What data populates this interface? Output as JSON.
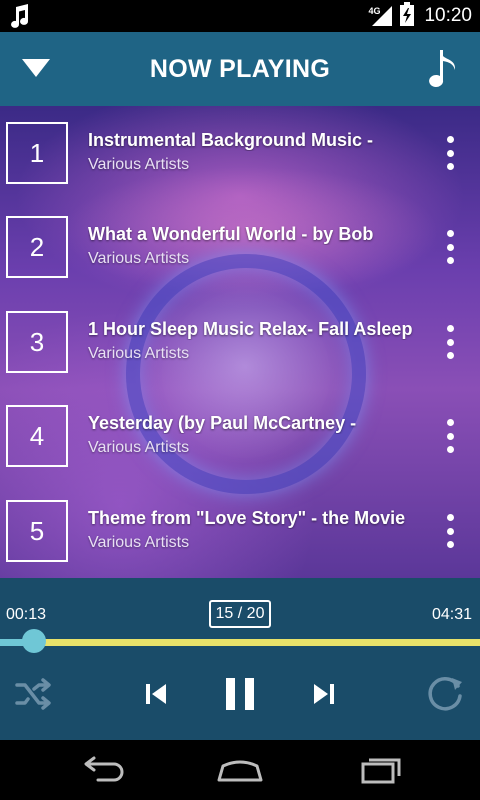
{
  "status_bar": {
    "notification_icon": "music-note-icon",
    "network_label": "4G",
    "time": "10:20"
  },
  "header": {
    "title": "NOW PLAYING",
    "left_icon": "chevron-down-icon",
    "right_icon": "music-note-icon"
  },
  "playlist": [
    {
      "number": "1",
      "title": "Instrumental Background Music -",
      "artist": "Various Artists"
    },
    {
      "number": "2",
      "title": "What a Wonderful World - by Bob",
      "artist": "Various Artists"
    },
    {
      "number": "3",
      "title": "1 Hour Sleep Music Relax- Fall Asleep",
      "artist": "Various Artists"
    },
    {
      "number": "4",
      "title": "Yesterday (by Paul McCartney -",
      "artist": "Various Artists"
    },
    {
      "number": "5",
      "title": "Theme from \"Love Story\" - the Movie",
      "artist": "Various Artists"
    }
  ],
  "player": {
    "current_time": "00:13",
    "total_time": "04:31",
    "track_counter": "15 / 20",
    "progress_fraction": 0.048,
    "controls": [
      "shuffle-icon",
      "previous-icon",
      "pause-icon",
      "next-icon",
      "repeat-icon"
    ]
  },
  "colors": {
    "header_bg": "#1f6485",
    "player_bg": "#1a4c69",
    "progress_remaining": "#e8e26a",
    "progress_played": "#6fc7d6"
  },
  "nav_bar": {
    "icons": [
      "back-icon",
      "home-icon",
      "recents-icon"
    ]
  }
}
